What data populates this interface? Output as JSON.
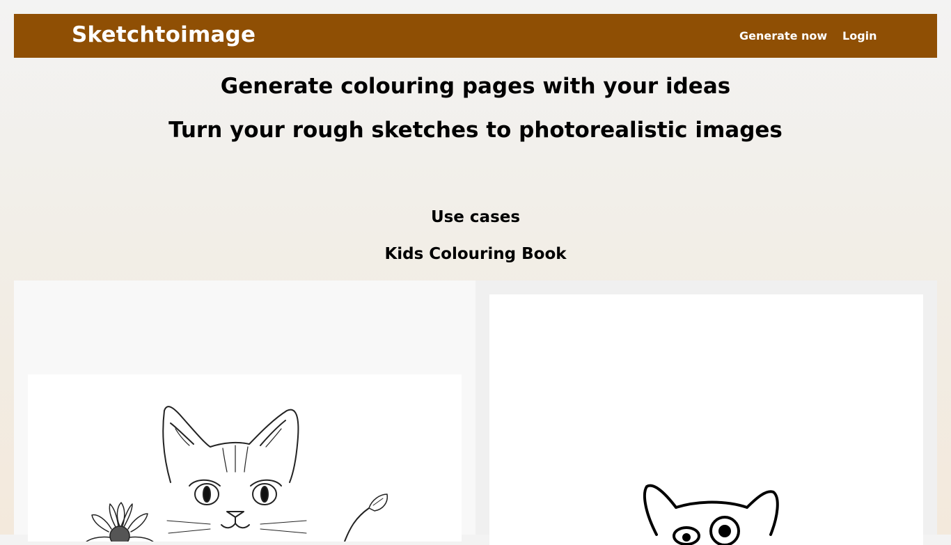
{
  "navbar": {
    "brand": "Sketchtoimage",
    "links": [
      {
        "label": "Generate now"
      },
      {
        "label": "Login"
      }
    ]
  },
  "hero": {
    "headline_1": "Generate colouring pages with your ideas",
    "headline_2": "Turn your rough sketches to photorealistic images"
  },
  "use_cases": {
    "title": "Use cases",
    "category": "Kids Colouring Book"
  },
  "colors": {
    "navbar_bg": "#8f4f04",
    "brand_text": "#ffffff"
  }
}
